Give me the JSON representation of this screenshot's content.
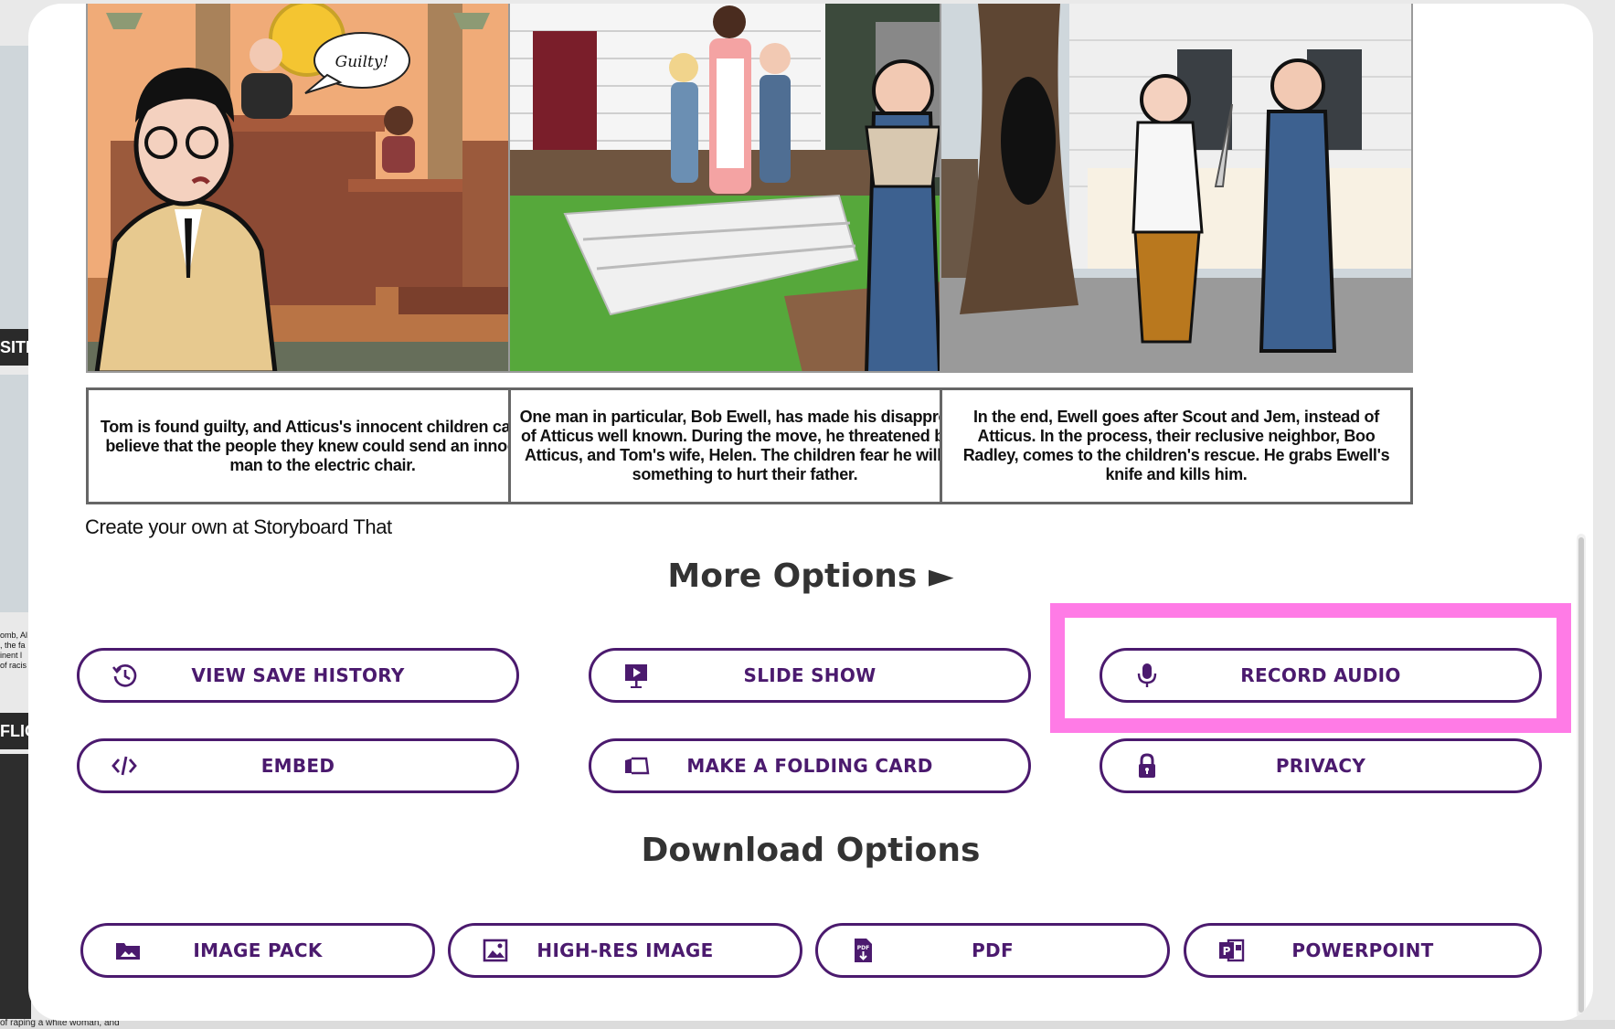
{
  "panels": [
    {
      "speech_bubble": "Guilty!",
      "caption": "Tom is found guilty, and Atticus's innocent children cannot believe that the people they knew could send an innocent man to the electric chair."
    },
    {
      "caption": "One man in particular, Bob Ewell, has made his disapproval of Atticus well known. During the move, he threatened both Atticus, and Tom's wife, Helen. The children fear he will do something to hurt their father."
    },
    {
      "caption": "In the end, Ewell goes after Scout and Jem, instead of Atticus. In the process, their reclusive neighbor, Boo Radley, comes to the children's rescue. He grabs Ewell's knife and kills him."
    }
  ],
  "credit": "Create your own at Storyboard That",
  "more_options": {
    "title": "More Options ►",
    "buttons": [
      {
        "label": "VIEW SAVE HISTORY",
        "icon": "history-icon"
      },
      {
        "label": "SLIDE SHOW",
        "icon": "presentation-icon"
      },
      {
        "label": "RECORD AUDIO",
        "icon": "microphone-icon"
      },
      {
        "label": "EMBED",
        "icon": "code-icon"
      },
      {
        "label": "MAKE A FOLDING CARD",
        "icon": "folding-card-icon"
      },
      {
        "label": "PRIVACY",
        "icon": "lock-icon"
      }
    ]
  },
  "download_options": {
    "title": "Download Options",
    "buttons": [
      {
        "label": "IMAGE PACK",
        "icon": "image-folder-icon"
      },
      {
        "label": "HIGH-RES IMAGE",
        "icon": "image-icon"
      },
      {
        "label": "PDF",
        "icon": "pdf-icon"
      },
      {
        "label": "POWERPOINT",
        "icon": "powerpoint-icon"
      }
    ]
  },
  "background": {
    "side_labels": [
      "SITIC",
      "FLIC"
    ],
    "side_snippet": "omb, Al\n, the fa\ninent l\nof racis",
    "bottom_text": "of raping a white woman, and"
  },
  "colors": {
    "accent": "#4b1a6e",
    "highlight": "#ff7be6"
  }
}
